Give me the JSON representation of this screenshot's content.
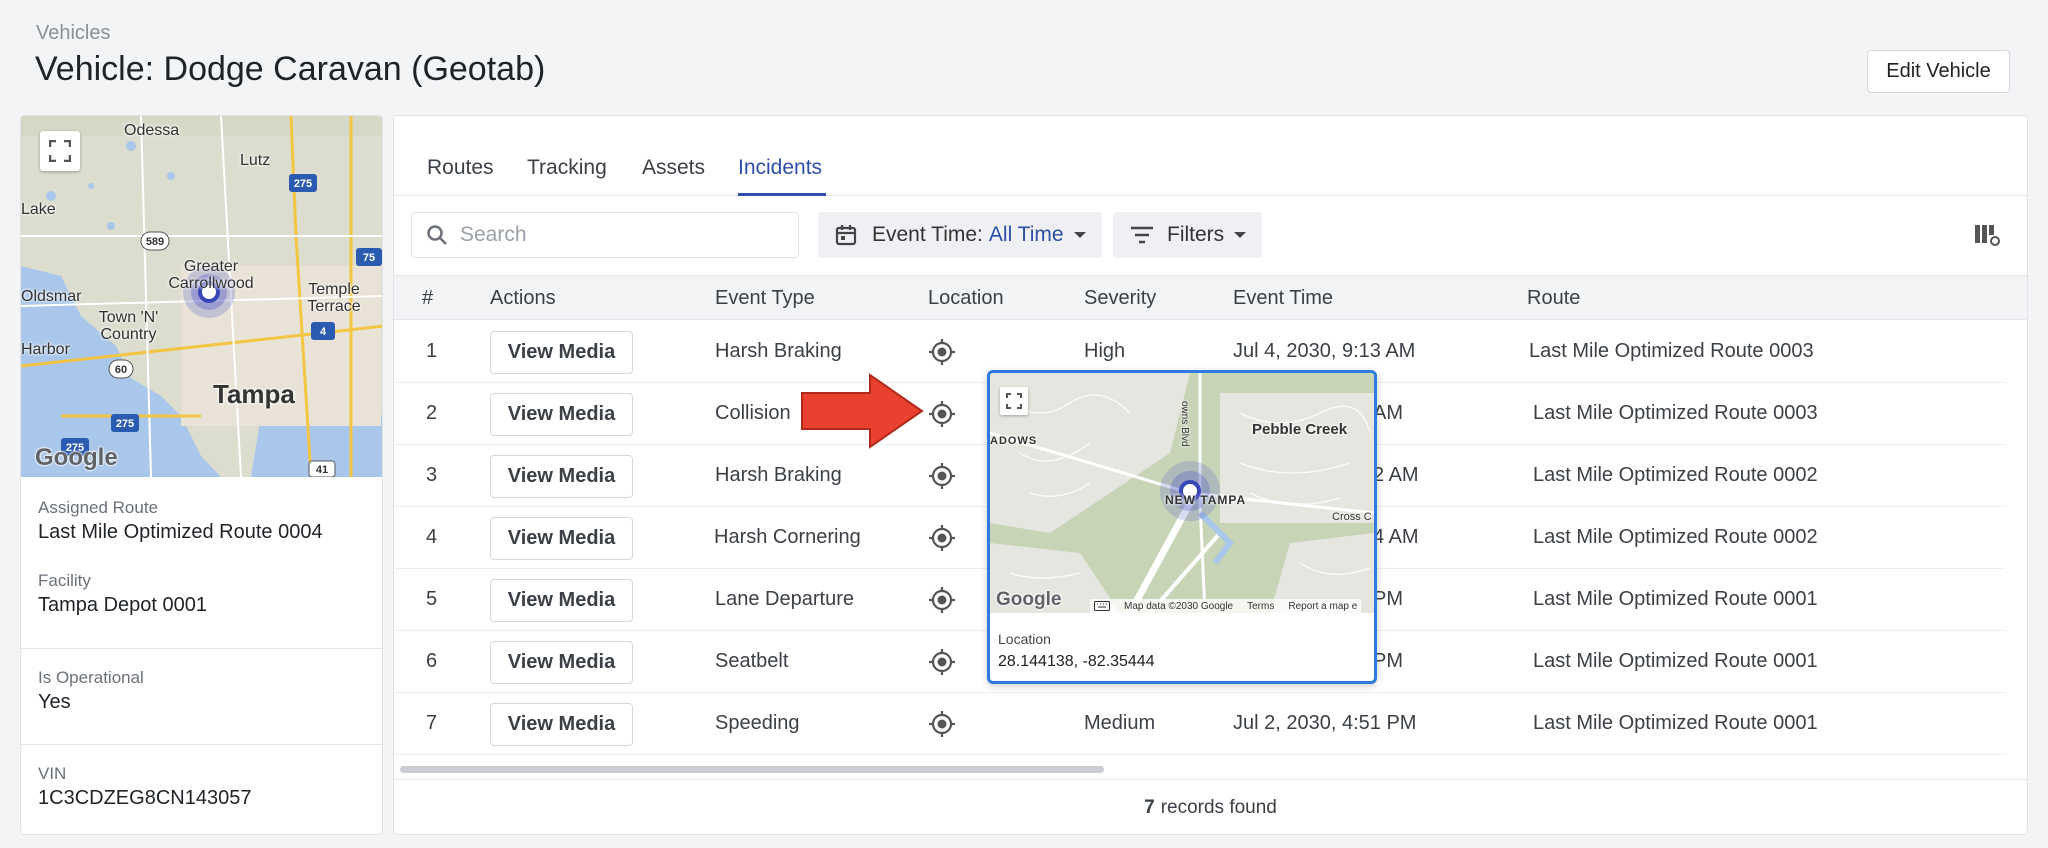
{
  "header": {
    "breadcrumb": "Vehicles",
    "title": "Vehicle: Dodge Caravan (Geotab)",
    "edit_label": "Edit Vehicle"
  },
  "sidebar": {
    "map": {
      "labels": [
        "Odessa",
        "Lutz",
        "Lake",
        "Greater Carrollwood",
        "Temple Terrace",
        "Oldsmar",
        "Town 'N' Country",
        "Harbor",
        "Tampa"
      ],
      "shields": [
        "275",
        "589",
        "75",
        "60",
        "4",
        "275",
        "275",
        "41"
      ],
      "google": "Google"
    },
    "fields": [
      {
        "label": "Assigned Route",
        "value": "Last Mile Optimized Route 0004"
      },
      {
        "label": "Facility",
        "value": "Tampa Depot 0001"
      },
      {
        "label": "Is Operational",
        "value": "Yes"
      },
      {
        "label": "VIN",
        "value": "1C3CDZEG8CN143057"
      }
    ]
  },
  "tabs": [
    {
      "label": "Routes"
    },
    {
      "label": "Tracking"
    },
    {
      "label": "Assets"
    },
    {
      "label": "Incidents",
      "active": true
    }
  ],
  "toolbar": {
    "search_placeholder": "Search",
    "event_time_label": "Event Time:",
    "event_time_value": "All Time",
    "filters_label": "Filters"
  },
  "table": {
    "columns": [
      "#",
      "Actions",
      "Event Type",
      "Location",
      "Severity",
      "Event Time",
      "Route"
    ],
    "action_label": "View Media",
    "rows": [
      {
        "num": "1",
        "event_type": "Harsh Braking",
        "severity": "High",
        "event_time": "Jul 4, 2030, 9:13 AM",
        "route": "Last Mile Optimized Route 0003"
      },
      {
        "num": "2",
        "event_type": "Collision",
        "severity": "",
        "event_time": "AM",
        "route": "Last Mile Optimized Route 0003"
      },
      {
        "num": "3",
        "event_type": "Harsh Braking",
        "severity": "",
        "event_time": "2 AM",
        "route": "Last Mile Optimized Route 0002"
      },
      {
        "num": "4",
        "event_type": "Harsh Cornering",
        "severity": "",
        "event_time": "4 AM",
        "route": "Last Mile Optimized Route 0002"
      },
      {
        "num": "5",
        "event_type": "Lane Departure",
        "severity": "",
        "event_time": "PM",
        "route": "Last Mile Optimized Route 0001"
      },
      {
        "num": "6",
        "event_type": "Seatbelt",
        "severity": "",
        "event_time": "PM",
        "route": "Last Mile Optimized Route 0001"
      },
      {
        "num": "7",
        "event_type": "Speeding",
        "severity": "Medium",
        "event_time": "Jul 2, 2030, 4:51 PM",
        "route": "Last Mile Optimized Route 0001"
      }
    ],
    "records_count": "7",
    "records_label": "records found"
  },
  "popup": {
    "map_labels": [
      "Pebble Creek",
      "NEW TAMPA",
      "ADOWS",
      "Cross C",
      "owns Blvd"
    ],
    "google": "Google",
    "attribution": {
      "data": "Map data ©2030 Google",
      "terms": "Terms",
      "report": "Report a map e"
    },
    "location_label": "Location",
    "location_value": "28.144138, -82.35444"
  },
  "colors": {
    "accent": "#2d4fa8",
    "popup_border": "#2f7ae0",
    "arrow": "#e8412f"
  }
}
